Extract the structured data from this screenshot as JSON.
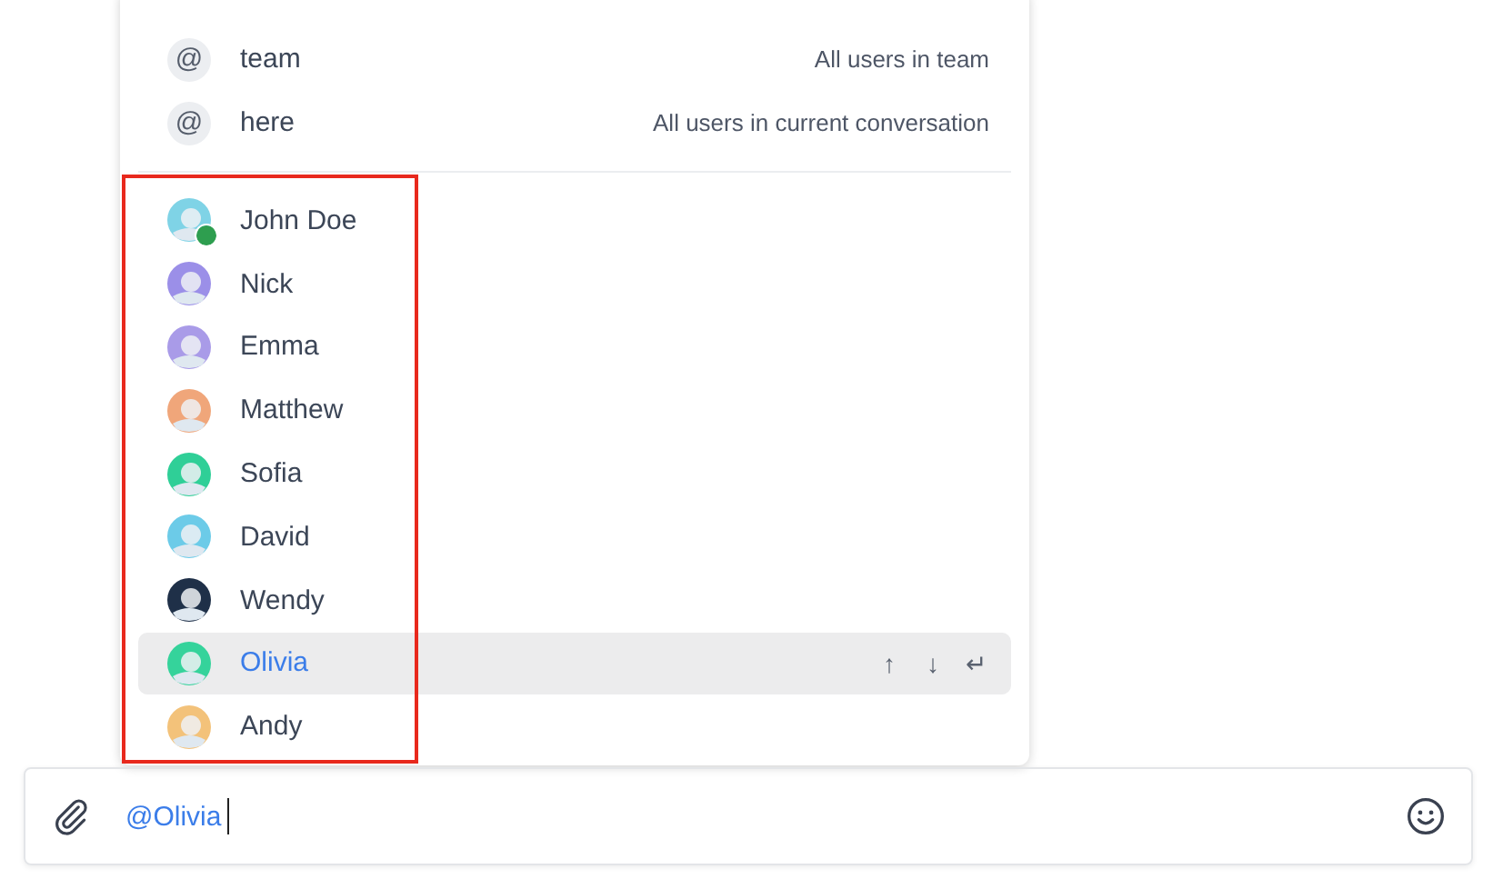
{
  "mentions": [
    {
      "symbol": "@",
      "name": "team",
      "description": "All users in team"
    },
    {
      "symbol": "@",
      "name": "here",
      "description": "All users in current conversation"
    }
  ],
  "users": [
    {
      "name": "John Doe",
      "color": "#7fd3e6",
      "online": true,
      "selected": false
    },
    {
      "name": "Nick",
      "color": "#9b8fe8",
      "online": false,
      "selected": false
    },
    {
      "name": "Emma",
      "color": "#a99be8",
      "online": false,
      "selected": false
    },
    {
      "name": "Matthew",
      "color": "#f0a67a",
      "online": false,
      "selected": false
    },
    {
      "name": "Sofia",
      "color": "#2fcf97",
      "online": false,
      "selected": false
    },
    {
      "name": "David",
      "color": "#6ccbe8",
      "online": false,
      "selected": false
    },
    {
      "name": "Wendy",
      "color": "#1f3048",
      "online": false,
      "selected": false
    },
    {
      "name": "Olivia",
      "color": "#35d39b",
      "online": false,
      "selected": true
    },
    {
      "name": "Andy",
      "color": "#f3c27a",
      "online": false,
      "selected": false
    }
  ],
  "key_hints": [
    "↑",
    "↓",
    "↵"
  ],
  "highlight": {
    "shown": true
  },
  "composer": {
    "value": "@Olivia"
  }
}
